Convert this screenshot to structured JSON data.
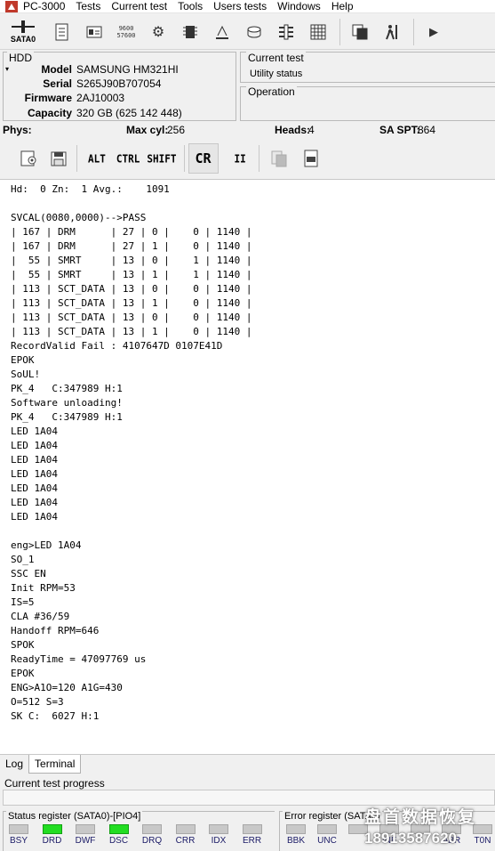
{
  "app": {
    "title": "PC-3000",
    "menu": [
      "Tests",
      "Current test",
      "Tools",
      "Users tests",
      "Windows",
      "Help"
    ]
  },
  "toolbar": {
    "sata_label": "SATA0",
    "buttons": [
      {
        "name": "scroll-icon",
        "glyph": "📜"
      },
      {
        "name": "id-card-icon",
        "glyph": "▦"
      },
      {
        "name": "speed-icon",
        "glyph": "9600\n57600"
      },
      {
        "name": "gears-icon",
        "glyph": "⚙"
      },
      {
        "name": "chip-icon",
        "glyph": "▥"
      },
      {
        "name": "scale-icon",
        "glyph": "⩩"
      },
      {
        "name": "disk-icon",
        "glyph": "⛁"
      },
      {
        "name": "equalizer-icon",
        "glyph": "≑"
      },
      {
        "name": "grid-icon",
        "glyph": "▦"
      },
      {
        "name": "copy-icon",
        "glyph": "❐"
      },
      {
        "name": "person-icon",
        "glyph": "⚲"
      },
      {
        "name": "play-icon",
        "glyph": "▶"
      }
    ]
  },
  "hdd": {
    "title": "HDD",
    "fields": [
      {
        "key": "Model",
        "value": "SAMSUNG HM321HI"
      },
      {
        "key": "Serial",
        "value": "S265J90B707054"
      },
      {
        "key": "Firmware",
        "value": "2AJ10003"
      },
      {
        "key": "Capacity",
        "value": "320 GB (625 142 448)"
      }
    ]
  },
  "current_test": {
    "title": "Current test",
    "value": "Utility status"
  },
  "operation": {
    "title": "Operation"
  },
  "phys": {
    "label": "Phys:",
    "max_cyl_label": "Max cyl:",
    "max_cyl": "256",
    "heads_label": "Heads:",
    "heads": "4",
    "sa_spt_label": "SA SPT:",
    "sa_spt": "864"
  },
  "terminal_toolbar": {
    "alt": "ALT",
    "ctrl": "CTRL",
    "shift": "SHIFT",
    "cr": "CR",
    "pause": "II"
  },
  "terminal": {
    "lines": [
      "Hd:  0 Zn:  1 Avg.:    1091",
      "",
      "SVCAL(0080,0000)-->PASS",
      "| 167 | DRM      | 27 | 0 |    0 | 1140 |",
      "| 167 | DRM      | 27 | 1 |    0 | 1140 |",
      "|  55 | SMRT     | 13 | 0 |    1 | 1140 |",
      "|  55 | SMRT     | 13 | 1 |    1 | 1140 |",
      "| 113 | SCT_DATA | 13 | 0 |    0 | 1140 |",
      "| 113 | SCT_DATA | 13 | 1 |    0 | 1140 |",
      "| 113 | SCT_DATA | 13 | 0 |    0 | 1140 |",
      "| 113 | SCT_DATA | 13 | 1 |    0 | 1140 |",
      "RecordValid Fail : 4107647D 0107E41D",
      "EPOK",
      "SoUL!",
      "PK_4   C:347989 H:1",
      "Software unloading!",
      "PK_4   C:347989 H:1",
      "LED 1A04",
      "LED 1A04",
      "LED 1A04",
      "LED 1A04",
      "LED 1A04",
      "LED 1A04",
      "LED 1A04",
      "",
      "eng>LED 1A04",
      "SO_1",
      "SSC EN",
      "Init RPM=53",
      "IS=5",
      "CLA #36/59",
      "Handoff RPM=646",
      "SPOK",
      "ReadyTime = 47097769 us",
      "EPOK",
      "ENG>A1O=120 A1G=430",
      "O=512 S=3",
      "SK C:  6027 H:1"
    ]
  },
  "tabs": {
    "log": "Log",
    "terminal": "Terminal"
  },
  "progress": {
    "label": "Current test progress"
  },
  "status_register": {
    "title": "Status register (SATA0)-[PIO4]",
    "bits": [
      {
        "name": "BSY",
        "on": false
      },
      {
        "name": "DRD",
        "on": true
      },
      {
        "name": "DWF",
        "on": false
      },
      {
        "name": "DSC",
        "on": true
      },
      {
        "name": "DRQ",
        "on": false
      },
      {
        "name": "CRR",
        "on": false
      },
      {
        "name": "IDX",
        "on": false
      },
      {
        "name": "ERR",
        "on": false
      }
    ]
  },
  "error_register": {
    "title": "Error register (SATA0)",
    "bits": [
      {
        "name": "BBK",
        "on": false
      },
      {
        "name": "UNC",
        "on": false
      },
      {
        "name": "",
        "on": false
      },
      {
        "name": "INF",
        "on": false
      },
      {
        "name": "",
        "on": false
      },
      {
        "name": "ABR",
        "on": false
      },
      {
        "name": "T0N",
        "on": false
      }
    ]
  },
  "watermark": {
    "line1": "盘首数据恢复",
    "line2": "18913587620"
  }
}
